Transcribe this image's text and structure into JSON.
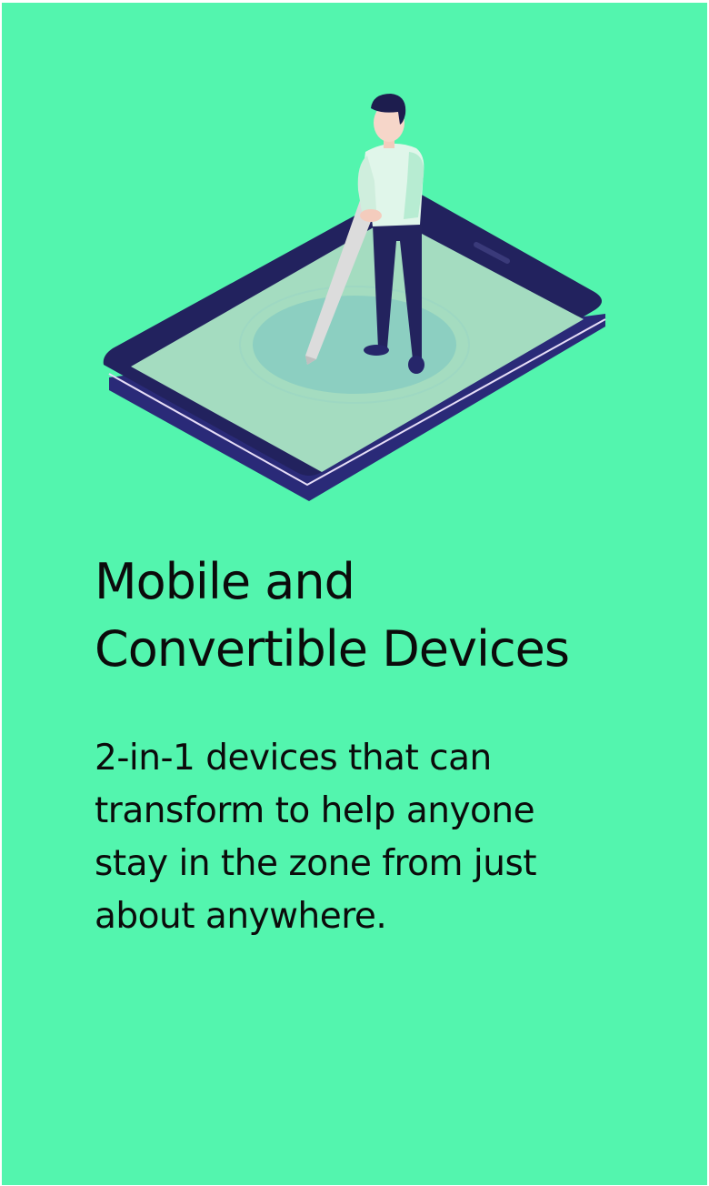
{
  "card": {
    "title_line1": "Mobile and",
    "title_line2": "Convertible Devices",
    "description": "2-in-1 devices that can transform to help anyone stay in the zone from just about anywhere.",
    "background_color": "#53f5ae"
  },
  "illustration": {
    "subject": "person-with-stylus-on-tablet",
    "colors": {
      "tablet_frame": "#22225e",
      "tablet_screen": "#a4dcc0",
      "person_shirt": "#e0f6ea",
      "person_pants": "#23235e",
      "stylus": "#dcdcdc"
    }
  }
}
